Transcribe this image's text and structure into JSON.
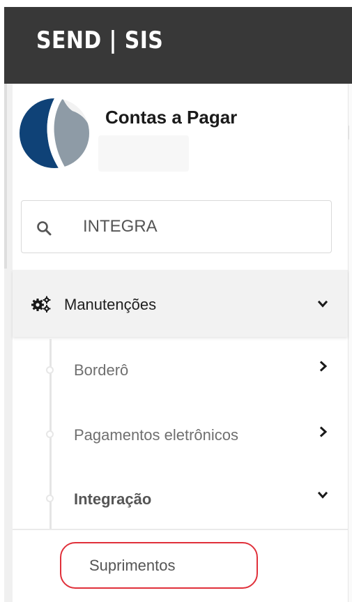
{
  "topbar": {
    "brand": "SEND | SIS",
    "background_color": "#383838"
  },
  "app": {
    "logo": "company-logo",
    "title": "Contas a Pagar"
  },
  "search": {
    "icon": "search-icon",
    "value": "INTEGRA"
  },
  "menu": {
    "group": {
      "icon": "gears-icon",
      "label": "Manutenções",
      "chevron": "chevron-down-icon"
    },
    "items": [
      {
        "label": "Borderô",
        "chevron": "chevron-right-icon"
      },
      {
        "label": "Pagamentos eletrônicos",
        "chevron": "chevron-right-icon"
      },
      {
        "label": "Integração",
        "chevron": "chevron-down-icon"
      }
    ],
    "leaf": {
      "label": "Suprimentos",
      "highlight_color": "#e0303a"
    }
  }
}
